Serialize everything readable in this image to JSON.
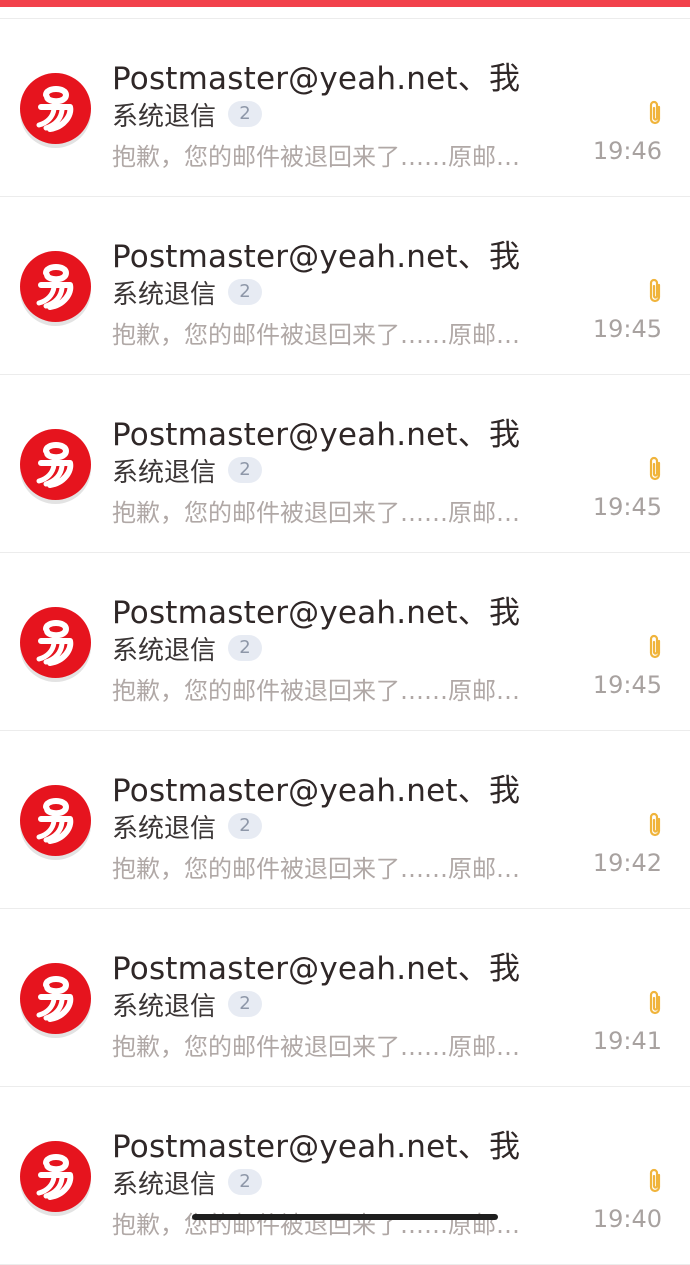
{
  "colors": {
    "accent": "#f2414b",
    "avatar_red": "#e6141e",
    "attachment_icon": "#f0b43c"
  },
  "mails": [
    {
      "sender": "Postmaster@yeah.net、我",
      "subject": "系统退信",
      "count": "2",
      "preview": "抱歉，您的邮件被退回来了……原邮…",
      "time": "19:46",
      "avatar_icon": "netease-yi-logo-icon",
      "attachment_icon": "paperclip-icon"
    },
    {
      "sender": "Postmaster@yeah.net、我",
      "subject": "系统退信",
      "count": "2",
      "preview": "抱歉，您的邮件被退回来了……原邮…",
      "time": "19:45",
      "avatar_icon": "netease-yi-logo-icon",
      "attachment_icon": "paperclip-icon"
    },
    {
      "sender": "Postmaster@yeah.net、我",
      "subject": "系统退信",
      "count": "2",
      "preview": "抱歉，您的邮件被退回来了……原邮…",
      "time": "19:45",
      "avatar_icon": "netease-yi-logo-icon",
      "attachment_icon": "paperclip-icon"
    },
    {
      "sender": "Postmaster@yeah.net、我",
      "subject": "系统退信",
      "count": "2",
      "preview": "抱歉，您的邮件被退回来了……原邮…",
      "time": "19:45",
      "avatar_icon": "netease-yi-logo-icon",
      "attachment_icon": "paperclip-icon"
    },
    {
      "sender": "Postmaster@yeah.net、我",
      "subject": "系统退信",
      "count": "2",
      "preview": "抱歉，您的邮件被退回来了……原邮…",
      "time": "19:42",
      "avatar_icon": "netease-yi-logo-icon",
      "attachment_icon": "paperclip-icon"
    },
    {
      "sender": "Postmaster@yeah.net、我",
      "subject": "系统退信",
      "count": "2",
      "preview": "抱歉，您的邮件被退回来了……原邮…",
      "time": "19:41",
      "avatar_icon": "netease-yi-logo-icon",
      "attachment_icon": "paperclip-icon"
    },
    {
      "sender": "Postmaster@yeah.net、我",
      "subject": "系统退信",
      "count": "2",
      "preview": "抱歉，您的邮件被退回来了……原邮…",
      "time": "19:40",
      "avatar_icon": "netease-yi-logo-icon",
      "attachment_icon": "paperclip-icon"
    }
  ]
}
